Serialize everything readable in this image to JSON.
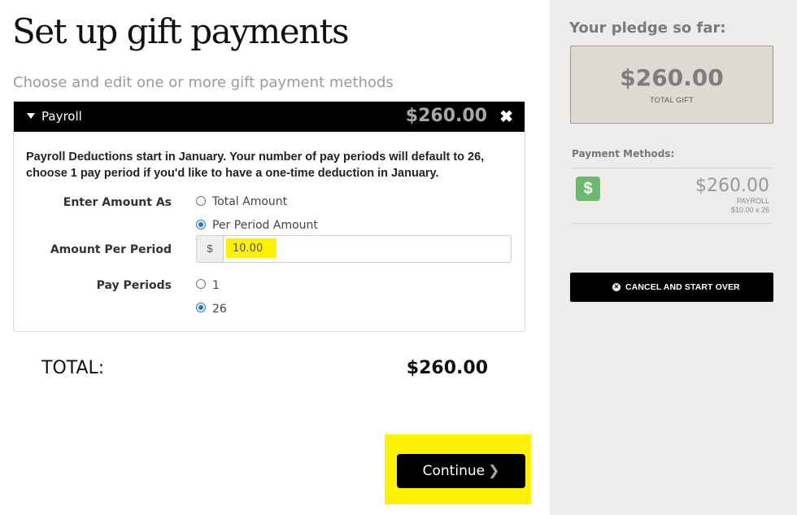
{
  "page": {
    "title": "Set up gift payments",
    "subtitle": "Choose and edit one or more gift payment methods"
  },
  "payroll_card": {
    "title": "Payroll",
    "amount": "$260.00",
    "close_icon": "close-icon",
    "notice": "Payroll Deductions start in January. Your number of pay periods will default to 26, choose 1 pay period if you'd like to have a one-time deduction in January.",
    "enter_amount_as": {
      "label": "Enter Amount As",
      "options": [
        "Total Amount",
        "Per Period Amount"
      ],
      "selected": "Per Period Amount"
    },
    "amount_per_period": {
      "label": "Amount Per Period",
      "prefix": "$",
      "value": "10.00"
    },
    "pay_periods": {
      "label": "Pay Periods",
      "options": [
        "1",
        "26"
      ],
      "selected": "26"
    }
  },
  "total": {
    "label": "TOTAL:",
    "value": "$260.00"
  },
  "continue_button": {
    "label": "Continue",
    "icon": "chevron-right-icon"
  },
  "sidebar": {
    "pledge_title": "Your pledge so far:",
    "pledge_amount": "$260.00",
    "pledge_caption": "TOTAL GIFT",
    "payment_methods_title": "Payment Methods:",
    "methods": [
      {
        "icon": "dollar-icon",
        "amount": "$260.00",
        "type": "PAYROLL",
        "detail": "$10.00 x 26"
      }
    ],
    "cancel_button": "CANCEL AND START OVER"
  },
  "colors": {
    "highlight": "#fff200",
    "header_bg": "#000000",
    "sidebar_bg": "#eeecea",
    "payment_icon_green": "#6cb86f",
    "radio_blue": "#1a73e8"
  }
}
